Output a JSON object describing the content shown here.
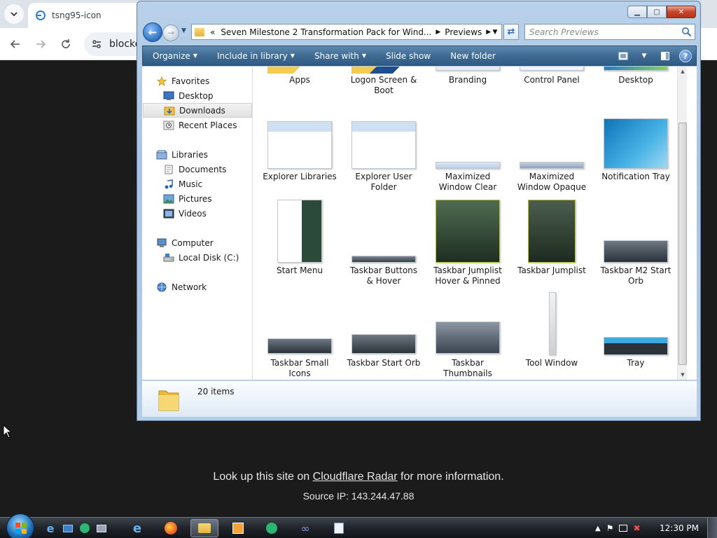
{
  "browser": {
    "tab_title": "tsng95-icon",
    "omnibox_text": "blocke",
    "radar_prefix": "Look up this site on ",
    "radar_link": "Cloudflare Radar",
    "radar_suffix": " for more information.",
    "source_ip": "Source IP: 143.244.47.88"
  },
  "window": {
    "breadcrumb_overflow": "«",
    "breadcrumb": [
      "Seven Milestone 2 Transformation Pack for Wind...",
      "Previews"
    ],
    "search_placeholder": "Search Previews",
    "commands": [
      {
        "label": "Organize",
        "has_menu": true
      },
      {
        "label": "Include in library",
        "has_menu": true
      },
      {
        "label": "Share with",
        "has_menu": true
      },
      {
        "label": "Slide show",
        "has_menu": false
      },
      {
        "label": "New folder",
        "has_menu": false
      }
    ],
    "nav": {
      "favorites": "Favorites",
      "desktop": "Desktop",
      "downloads": "Downloads",
      "recent_places": "Recent Places",
      "libraries": "Libraries",
      "documents": "Documents",
      "music": "Music",
      "pictures": "Pictures",
      "videos": "Videos",
      "computer": "Computer",
      "local_disk": "Local Disk (C:)",
      "network": "Network"
    },
    "files": [
      {
        "line1": "Apps",
        "line2": ""
      },
      {
        "line1": "Logon Screen &",
        "line2": "Boot"
      },
      {
        "line1": "Branding",
        "line2": ""
      },
      {
        "line1": "Control Panel",
        "line2": ""
      },
      {
        "line1": "Desktop",
        "line2": ""
      },
      {
        "line1": "Explorer Libraries",
        "line2": ""
      },
      {
        "line1": "Explorer User",
        "line2": "Folder"
      },
      {
        "line1": "Maximized",
        "line2": "Window Clear"
      },
      {
        "line1": "Maximized",
        "line2": "Window Opaque"
      },
      {
        "line1": "Notification Tray",
        "line2": ""
      },
      {
        "line1": "Start Menu",
        "line2": ""
      },
      {
        "line1": "Taskbar Buttons",
        "line2": "& Hover"
      },
      {
        "line1": "Taskbar Jumplist",
        "line2": "Hover & Pinned"
      },
      {
        "line1": "Taskbar Jumplist",
        "line2": ""
      },
      {
        "line1": "Taskbar M2 Start",
        "line2": "Orb"
      },
      {
        "line1": "Taskbar Small",
        "line2": "Icons"
      },
      {
        "line1": "Taskbar Start Orb",
        "line2": ""
      },
      {
        "line1": "Taskbar",
        "line2": "Thumbnails"
      },
      {
        "line1": "Tool Window",
        "line2": ""
      },
      {
        "line1": "Tray",
        "line2": ""
      }
    ],
    "item_count": "20 items"
  },
  "taskbar": {
    "clock": "12:30 PM"
  },
  "icons": {
    "tab_list": "chevron-down-icon",
    "back": "arrow-left-icon",
    "forward": "arrow-right-icon",
    "reload": "reload-icon",
    "site_info": "tune-icon",
    "search": "magnifier-icon",
    "help": "help-icon"
  }
}
